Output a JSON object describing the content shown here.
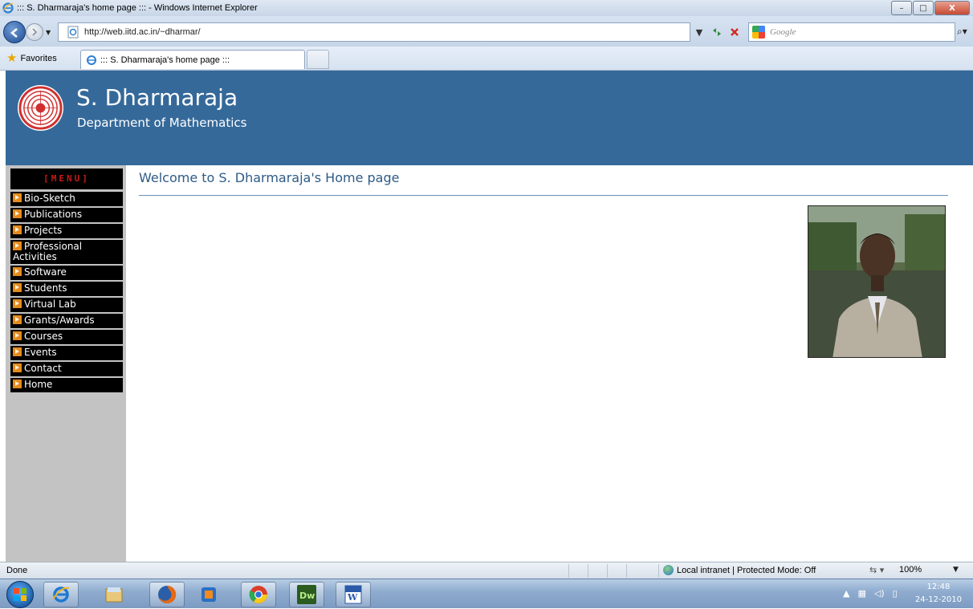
{
  "window": {
    "title": "::: S. Dharmaraja's home page ::: - Windows Internet Explorer",
    "controls": [
      "–",
      "□",
      "X"
    ]
  },
  "address_bar": {
    "url": "http://web.iitd.ac.in/~dharmar/",
    "search_provider": "Google"
  },
  "favorites_bar": {
    "favorites_label": "Favorites",
    "tab_label": "::: S. Dharmaraja's home page :::"
  },
  "header": {
    "name": "S. Dharmaraja",
    "department": "Department of Mathematics",
    "background_color": "#35699a"
  },
  "menu": {
    "heading": "[MENU]",
    "items": [
      {
        "label": "Bio-Sketch"
      },
      {
        "label": "Publications"
      },
      {
        "label": "Projects"
      },
      {
        "label": "Professional Activities"
      },
      {
        "label": "Software"
      },
      {
        "label": "Students"
      },
      {
        "label": "Virtual Lab"
      },
      {
        "label": "Grants/Awards"
      },
      {
        "label": "Courses"
      },
      {
        "label": "Events"
      },
      {
        "label": "Contact"
      },
      {
        "label": "Home"
      }
    ]
  },
  "main": {
    "welcome": "Welcome to S. Dharmaraja's Home page"
  },
  "status_bar": {
    "status": "Done",
    "zone": "Local intranet | Protected Mode: Off",
    "zoom": "100%"
  },
  "taskbar": {
    "time": "12:48",
    "date": "24-12-2010",
    "apps": [
      "internet-explorer",
      "file-explorer",
      "firefox",
      "media-player",
      "chrome",
      "dreamweaver",
      "word"
    ]
  }
}
